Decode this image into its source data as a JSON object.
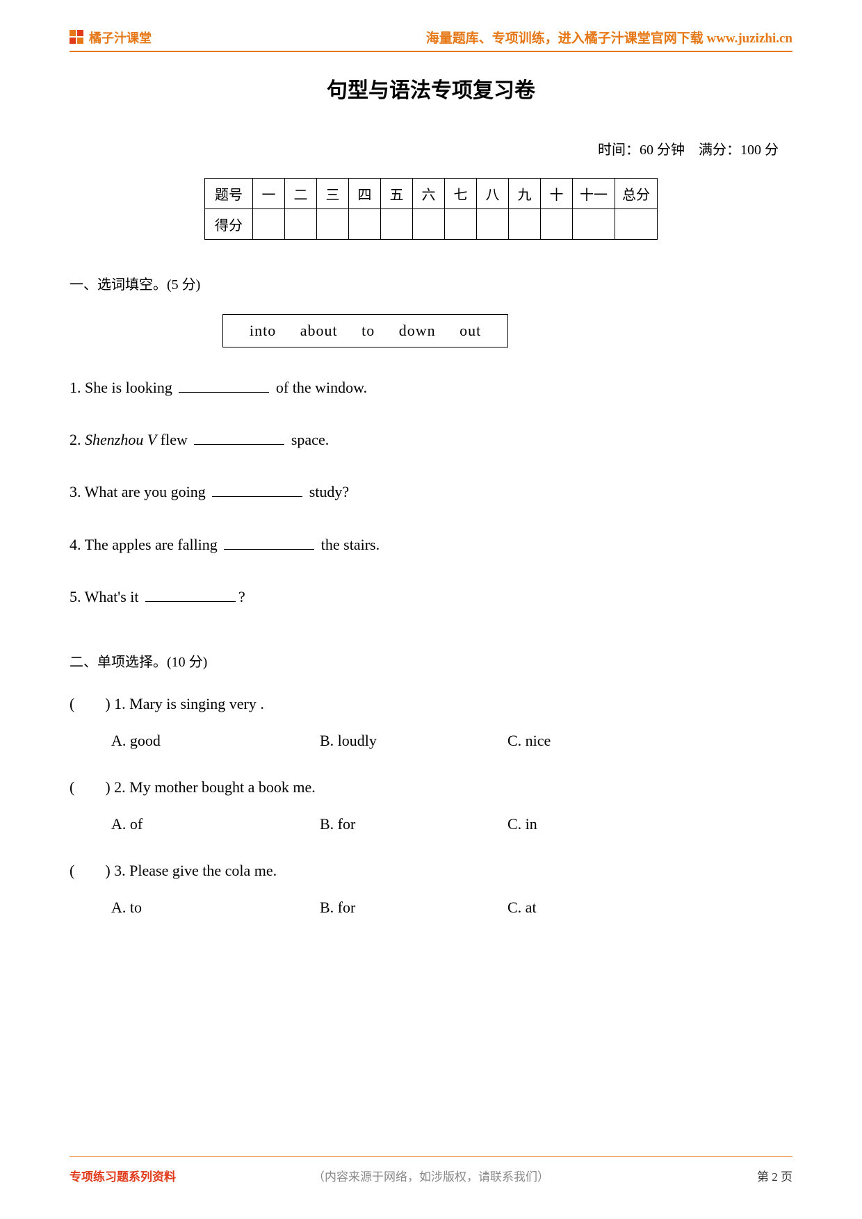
{
  "header": {
    "logo_text": "橘子汁课堂",
    "link_text": "海量题库、专项训练，进入橘子汁课堂官网下载 www.juzizhi.cn"
  },
  "title": "句型与语法专项复习卷",
  "meta": {
    "time_label": "时间：",
    "time_value": "60 分钟",
    "full_label": "满分：",
    "full_value": "100 分"
  },
  "score_table": {
    "row1_label": "题号",
    "cols": [
      "一",
      "二",
      "三",
      "四",
      "五",
      "六",
      "七",
      "八",
      "九",
      "十",
      "十一",
      "总分"
    ],
    "row2_label": "得分"
  },
  "section1": {
    "title": "一、选词填空。(5 分)",
    "words": [
      "into",
      "about",
      "to",
      "down",
      "out"
    ],
    "questions": [
      {
        "pre": "1. She is looking ",
        "post": " of the window."
      },
      {
        "pre_html": "2. <span class=\"italic\">Shenzhou V</span> flew ",
        "post": " space."
      },
      {
        "pre": "3. What are you going ",
        "post": " study?"
      },
      {
        "pre": "4. The apples are falling ",
        "post": " the stairs."
      },
      {
        "pre": "5. What's it ",
        "post": "?"
      }
    ]
  },
  "section2": {
    "title": "二、单项选择。(10 分)",
    "items": [
      {
        "stem_pre": "(　　) 1. Mary is singing very ",
        "stem_post": ".",
        "A": "A. good",
        "B": "B. loudly",
        "C": "C. nice"
      },
      {
        "stem_pre": "(　　) 2. My mother bought a book ",
        "stem_post": " me.",
        "A": "A. of",
        "B": "B. for",
        "C": "C. in"
      },
      {
        "stem_pre": "(　　) 3. Please give the cola ",
        "stem_post": " me.",
        "A": "A. to",
        "B": "B. for",
        "C": "C. at"
      }
    ]
  },
  "footer": {
    "left": "专项练习题系列资料",
    "mid": "（内容来源于网络，如涉版权，请联系我们）",
    "page_label": "第 2 页"
  }
}
